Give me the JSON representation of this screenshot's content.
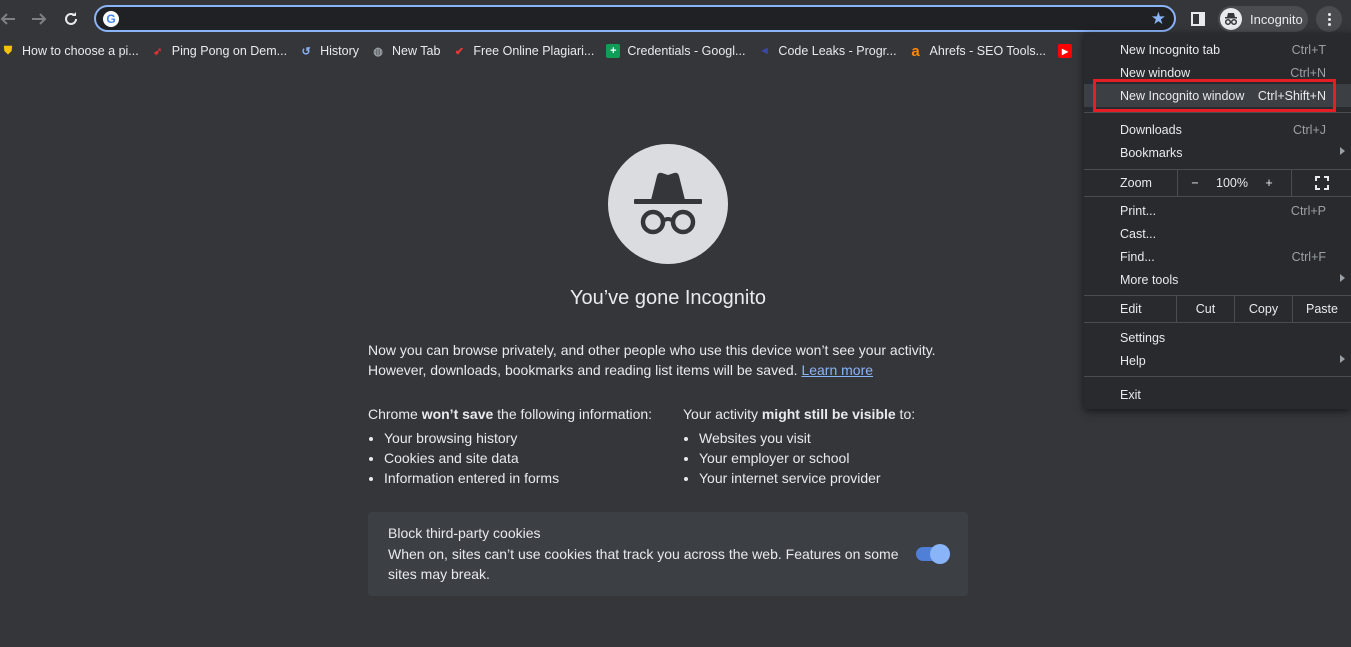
{
  "toolbar": {
    "omnibox_value": "",
    "profile_label": "Incognito"
  },
  "bookmarks": [
    {
      "label": "How to choose a pi...",
      "icon": "shield-logo-icon"
    },
    {
      "label": "Ping Pong on Dem...",
      "icon": "paddle-icon"
    },
    {
      "label": "History",
      "icon": "history-icon"
    },
    {
      "label": "New Tab",
      "icon": "globe-icon"
    },
    {
      "label": "Free Online Plagiari...",
      "icon": "checkmark-icon"
    },
    {
      "label": "Credentials - Googl...",
      "icon": "sheets-icon"
    },
    {
      "label": "Code Leaks - Progr...",
      "icon": "arrow-logo-icon"
    },
    {
      "label": "Ahrefs - SEO Tools...",
      "icon": "ahrefs-icon"
    }
  ],
  "main": {
    "title": "You’ve gone Incognito",
    "para_line1": "Now you can browse privately, and other people who use this device won’t see your activity.",
    "para_line2": "However, downloads, bookmarks and reading list items will be saved.",
    "learn_more": "Learn more",
    "left_col": {
      "head_pre": "Chrome ",
      "head_bold": "won’t save",
      "head_post": " the following information:",
      "items": [
        "Your browsing history",
        "Cookies and site data",
        "Information entered in forms"
      ]
    },
    "right_col": {
      "head_pre": "Your activity ",
      "head_bold": "might still be visible",
      "head_post": " to:",
      "items": [
        "Websites you visit",
        "Your employer or school",
        "Your internet service provider"
      ]
    },
    "cookies": {
      "title": "Block third-party cookies",
      "desc": "When on, sites can’t use cookies that track you across the web. Features on some sites may break.",
      "enabled": true
    }
  },
  "menu": {
    "new_incognito_tab": "New Incognito tab",
    "new_incognito_tab_sc": "Ctrl+T",
    "new_window": "New window",
    "new_window_sc": "Ctrl+N",
    "new_incognito_window": "New Incognito window",
    "new_incognito_window_sc": "Ctrl+Shift+N",
    "downloads": "Downloads",
    "downloads_sc": "Ctrl+J",
    "bookmarks": "Bookmarks",
    "zoom": "Zoom",
    "zoom_minus": "−",
    "zoom_value": "100%",
    "zoom_plus": "+",
    "print": "Print...",
    "print_sc": "Ctrl+P",
    "cast": "Cast...",
    "find": "Find...",
    "find_sc": "Ctrl+F",
    "more_tools": "More tools",
    "edit": "Edit",
    "cut": "Cut",
    "copy": "Copy",
    "paste": "Paste",
    "settings": "Settings",
    "help": "Help",
    "exit": "Exit"
  },
  "colors": {
    "background": "#35363a",
    "menu_bg": "#292a2d",
    "accent": "#8ab4f8",
    "highlight_box": "#e31e24"
  }
}
